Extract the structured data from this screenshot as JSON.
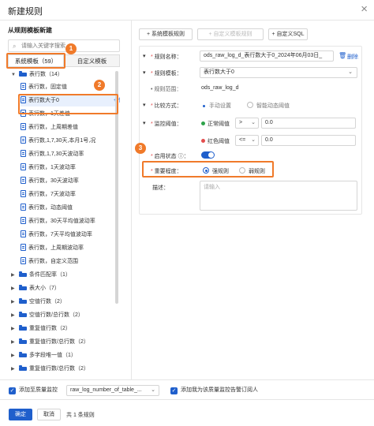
{
  "dialog": {
    "title": "新建规则",
    "close": "×"
  },
  "left": {
    "section_title": "从规则模板新建",
    "search_placeholder": "请输入关键字搜索",
    "tabs": [
      {
        "label": "系统模板（59）"
      },
      {
        "label": "自定义模板"
      }
    ],
    "tree": {
      "root": "表行数（14）",
      "children": [
        "表行数，固定值",
        "表行数大于0",
        "表行数，1天差值",
        "表行数，上周期差值",
        "表行数,1,7,30天,本月1号,况",
        "表行数,1,7,30天波动率",
        "表行数，1天波动率",
        "表行数，30天波动率",
        "表行数，7天波动率",
        "表行数，动态阈值",
        "表行数，30天平均值波动率",
        "表行数，7天平均值波动率",
        "表行数，上周期波动率",
        "表行数，自定义范围"
      ],
      "use_label": "+ 使用",
      "groups": [
        "条件匹配率（1）",
        "表大小（7）",
        "空值行数（2）",
        "空值行数/总行数（2）",
        "重复值行数（2）",
        "重复值行数/总行数（2）",
        "多字段唯一值（1）",
        "重复值行数/总行数（2）",
        "唯一值数（2）",
        "唯一值数/总行数（2）"
      ]
    }
  },
  "callouts": [
    "1",
    "2",
    "3"
  ],
  "toolbar": {
    "btn_system": "+ 系统模板规则",
    "btn_custom_template": "+ 自定义模板规则",
    "btn_custom_sql": "+ 自定义SQL"
  },
  "form": {
    "rule_name_label": "规则名称：",
    "rule_name_value": "ods_raw_log_d_表行数大于0_2024年06月03日_",
    "delete_label": "删除",
    "template_label": "规则模板：",
    "template_value": "表行数大于0",
    "scope_label": "规则范围：",
    "scope_value": "ods_raw_log_d",
    "compare_label": "比较方式：",
    "compare_manual": "手动设置",
    "compare_dynamic": "智能动态阈值",
    "threshold_label": "监控阈值：",
    "normal_label": "正常阈值",
    "normal_op": ">",
    "normal_value": "0.0",
    "red_label": "红色阈值",
    "red_op": "<=",
    "red_value": "0.0",
    "status_label": "启用状态",
    "importance_label": "重要程度：",
    "strong_rule": "强规则",
    "weak_rule": "弱规则",
    "desc_label": "描述：",
    "desc_placeholder": "请输入"
  },
  "footer": {
    "add_monitor_label": "添加至质量监控",
    "monitor_select": "raw_log_number_of_table_...",
    "subscribe_label": "添加我为该质量监控告警订阅人",
    "ok": "确定",
    "cancel": "取消",
    "count_text": "共 1 条规则"
  },
  "colors": {
    "primary": "#1f5fcc",
    "callout": "#f07a2a",
    "normal_dot": "#2ea34a",
    "red_dot": "#e34d4d"
  }
}
